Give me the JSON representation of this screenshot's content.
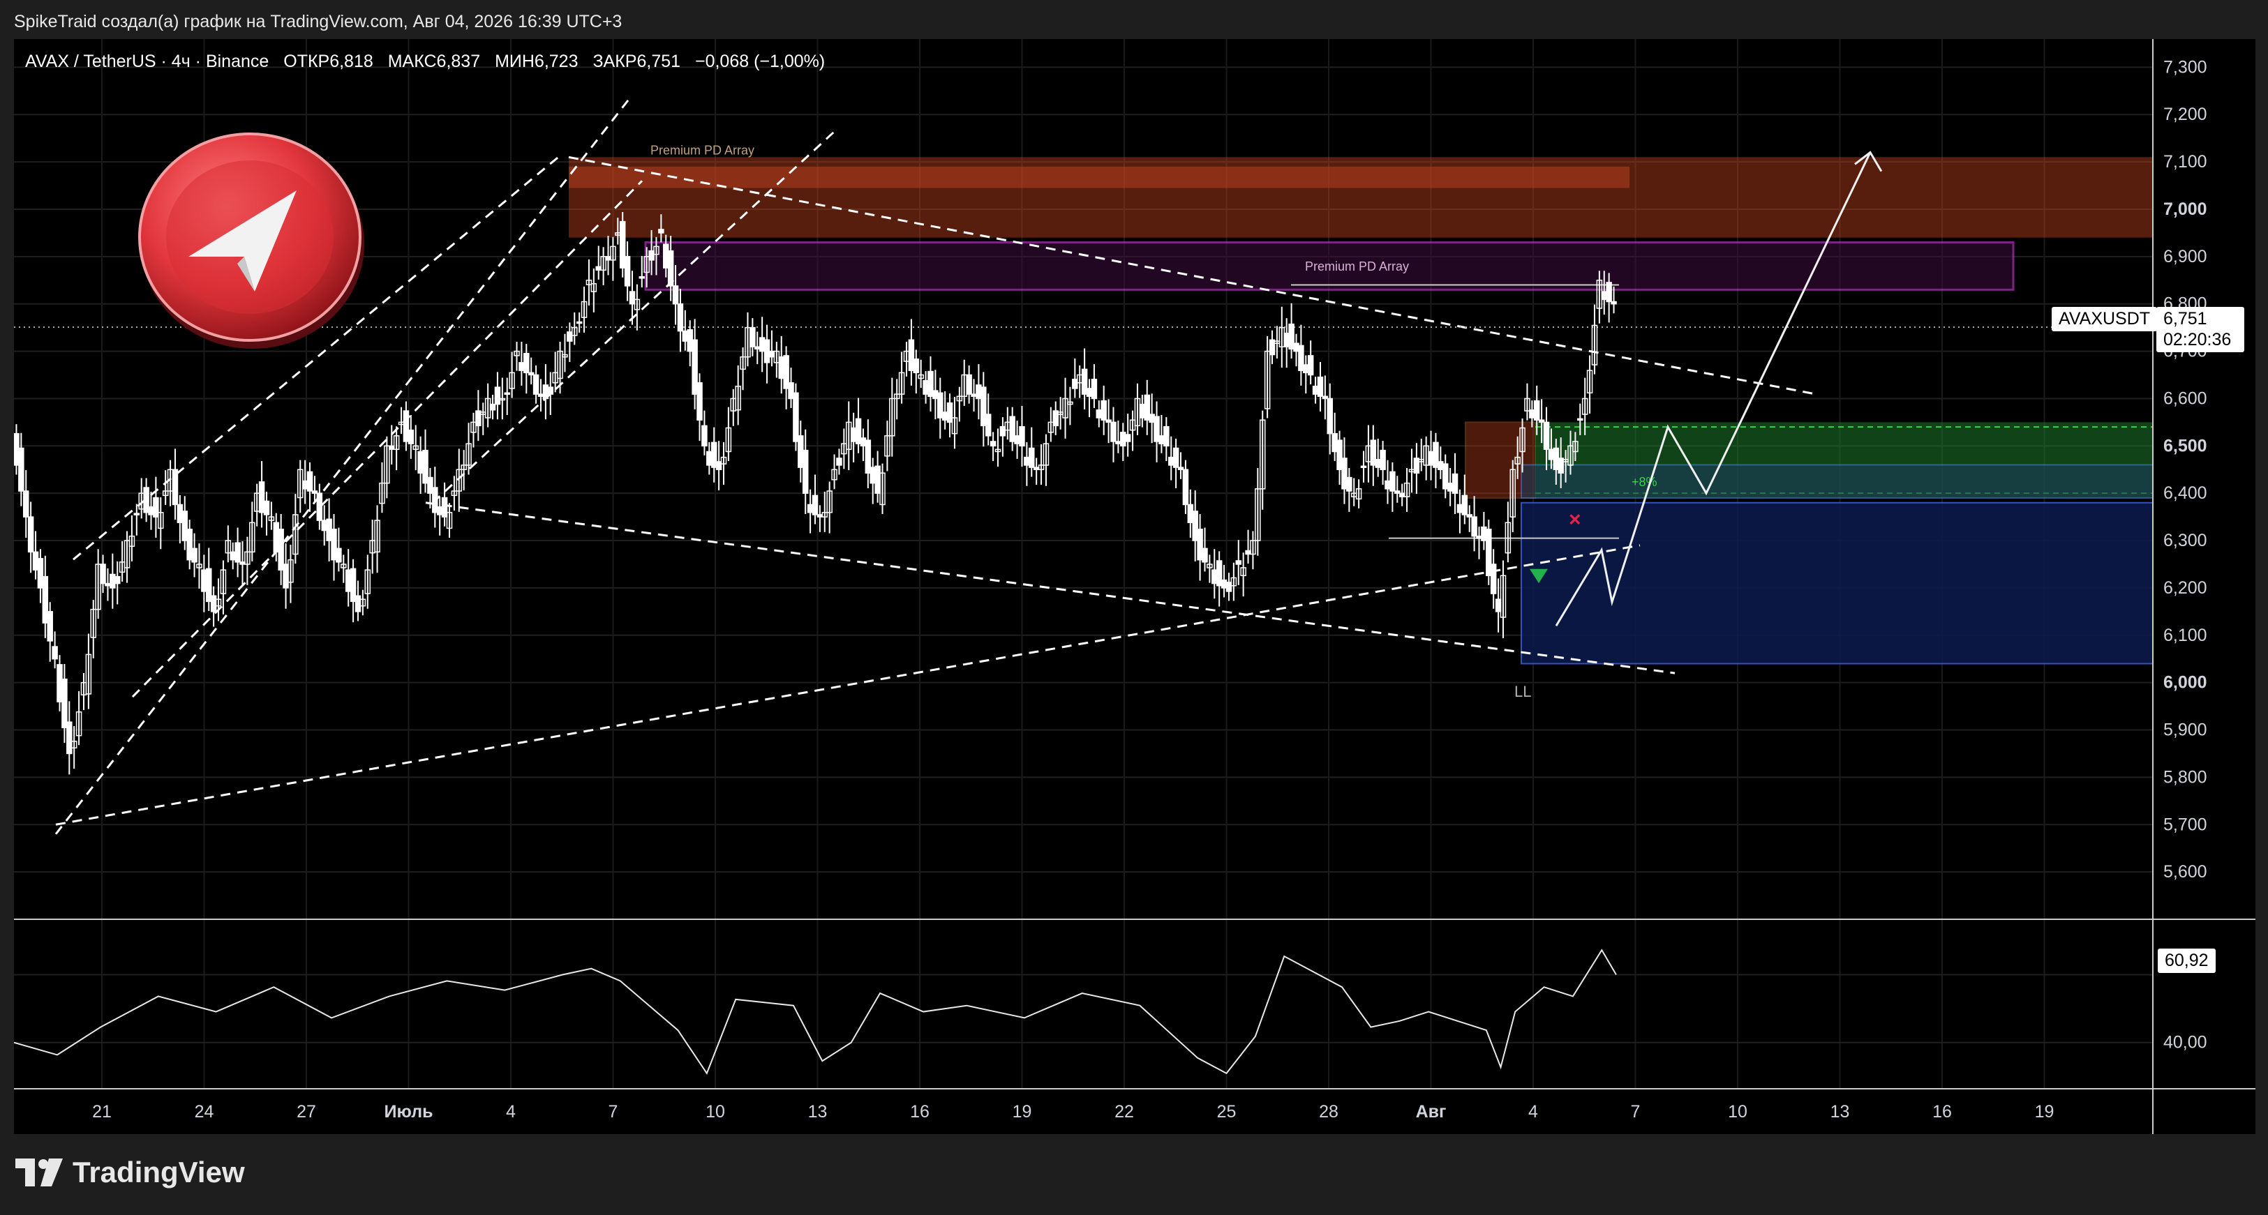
{
  "header": {
    "attribution": "SpikeTraid создал(а) график на TradingView.com, Авг 04, 2026 16:39 UTC+3"
  },
  "symbol": {
    "name": "AVAX / TetherUS · 4ч · Binance",
    "open": "ОТКР6,818",
    "high": "МАКС6,837",
    "low": "МИН6,723",
    "close": "ЗАКР6,751",
    "change": "−0,068 (−1,00%)"
  },
  "price_badge": {
    "ticker": "AVAXUSDT",
    "price": "6,751",
    "countdown": "02:20:36"
  },
  "rsi_badge": {
    "value": "60,92"
  },
  "annotations": {
    "premium_1": "Premium PD Array",
    "premium_2": "Premium PD Array",
    "ll": "LL",
    "plus_label": "+8%"
  },
  "footer": {
    "logo_text": "TradingView"
  },
  "colors": {
    "background": "#000000",
    "candle": "#ffffff",
    "premium_zone": "#c0421f",
    "magenta_box": "#c83cd6",
    "green_zone": "#1e7a2a",
    "blue_zone": "#0c1a4a",
    "trendline": "#ffffff",
    "logo_red": "#e1363c"
  },
  "chart_data": {
    "type": "candlestick",
    "interval": "4h",
    "price_axis_ticks": [
      "7,300",
      "7,200",
      "7,100",
      "7,000",
      "6,900",
      "6,800",
      "6,700",
      "6,600",
      "6,500",
      "6,400",
      "6,300",
      "6,200",
      "6,100",
      "6,000",
      "5,900",
      "5,800",
      "5,700",
      "5,600"
    ],
    "rsi_axis_ticks": [
      "40,00"
    ],
    "x_tick_labels": [
      "21",
      "24",
      "27",
      "Июль",
      "4",
      "7",
      "10",
      "13",
      "16",
      "19",
      "22",
      "25",
      "28",
      "Авг",
      "4",
      "7",
      "10",
      "13",
      "16",
      "19"
    ],
    "ylim": [
      5.5,
      7.33
    ],
    "rsi_ylim": [
      25,
      80
    ],
    "last_price": 6.751,
    "rsi_last": 60.92,
    "price_path": [
      [
        0,
        6.55
      ],
      [
        1,
        6.35
      ],
      [
        2,
        6.2
      ],
      [
        3,
        6.05
      ],
      [
        4,
        5.85
      ],
      [
        5,
        6.0
      ],
      [
        6,
        6.25
      ],
      [
        7,
        6.2
      ],
      [
        8,
        6.3
      ],
      [
        9,
        6.4
      ],
      [
        10,
        6.35
      ],
      [
        11,
        6.45
      ],
      [
        12,
        6.3
      ],
      [
        13,
        6.25
      ],
      [
        14,
        6.15
      ],
      [
        15,
        6.3
      ],
      [
        16,
        6.25
      ],
      [
        17,
        6.4
      ],
      [
        18,
        6.35
      ],
      [
        19,
        6.2
      ],
      [
        20,
        6.45
      ],
      [
        21,
        6.4
      ],
      [
        22,
        6.3
      ],
      [
        23,
        6.25
      ],
      [
        24,
        6.15
      ],
      [
        25,
        6.3
      ],
      [
        26,
        6.5
      ],
      [
        27,
        6.55
      ],
      [
        28,
        6.5
      ],
      [
        29,
        6.4
      ],
      [
        30,
        6.35
      ],
      [
        31,
        6.45
      ],
      [
        32,
        6.55
      ],
      [
        33,
        6.6
      ],
      [
        34,
        6.6
      ],
      [
        35,
        6.7
      ],
      [
        36,
        6.65
      ],
      [
        37,
        6.6
      ],
      [
        38,
        6.7
      ],
      [
        39,
        6.75
      ],
      [
        40,
        6.85
      ],
      [
        41,
        6.9
      ],
      [
        42,
        6.95
      ],
      [
        43,
        6.8
      ],
      [
        44,
        6.9
      ],
      [
        45,
        6.95
      ],
      [
        46,
        6.8
      ],
      [
        47,
        6.7
      ],
      [
        48,
        6.5
      ],
      [
        49,
        6.45
      ],
      [
        50,
        6.6
      ],
      [
        51,
        6.75
      ],
      [
        52,
        6.7
      ],
      [
        53,
        6.7
      ],
      [
        54,
        6.6
      ],
      [
        55,
        6.4
      ],
      [
        56,
        6.35
      ],
      [
        57,
        6.45
      ],
      [
        58,
        6.55
      ],
      [
        59,
        6.5
      ],
      [
        60,
        6.4
      ],
      [
        61,
        6.6
      ],
      [
        62,
        6.7
      ],
      [
        63,
        6.65
      ],
      [
        64,
        6.6
      ],
      [
        65,
        6.55
      ],
      [
        66,
        6.65
      ],
      [
        67,
        6.6
      ],
      [
        68,
        6.5
      ],
      [
        69,
        6.55
      ],
      [
        70,
        6.5
      ],
      [
        71,
        6.45
      ],
      [
        72,
        6.55
      ],
      [
        73,
        6.6
      ],
      [
        74,
        6.65
      ],
      [
        75,
        6.6
      ],
      [
        76,
        6.55
      ],
      [
        77,
        6.5
      ],
      [
        78,
        6.6
      ],
      [
        79,
        6.55
      ],
      [
        80,
        6.5
      ],
      [
        81,
        6.45
      ],
      [
        82,
        6.3
      ],
      [
        83,
        6.25
      ],
      [
        84,
        6.2
      ],
      [
        85,
        6.25
      ],
      [
        86,
        6.3
      ],
      [
        87,
        6.7
      ],
      [
        88,
        6.75
      ],
      [
        89,
        6.7
      ],
      [
        90,
        6.65
      ],
      [
        91,
        6.6
      ],
      [
        92,
        6.45
      ],
      [
        93,
        6.4
      ],
      [
        94,
        6.5
      ],
      [
        95,
        6.45
      ],
      [
        96,
        6.4
      ],
      [
        97,
        6.45
      ],
      [
        98,
        6.5
      ],
      [
        99,
        6.45
      ],
      [
        100,
        6.4
      ],
      [
        101,
        6.35
      ],
      [
        102,
        6.3
      ],
      [
        103,
        6.15
      ],
      [
        104,
        6.45
      ],
      [
        105,
        6.6
      ],
      [
        106,
        6.55
      ],
      [
        107,
        6.45
      ],
      [
        108,
        6.5
      ],
      [
        109,
        6.6
      ],
      [
        110,
        6.85
      ],
      [
        111,
        6.8
      ]
    ],
    "rsi_path": [
      [
        0,
        40
      ],
      [
        3,
        36
      ],
      [
        6,
        45
      ],
      [
        10,
        55
      ],
      [
        14,
        50
      ],
      [
        18,
        58
      ],
      [
        22,
        48
      ],
      [
        26,
        55
      ],
      [
        30,
        60
      ],
      [
        34,
        57
      ],
      [
        38,
        62
      ],
      [
        40,
        64
      ],
      [
        42,
        60
      ],
      [
        44,
        52
      ],
      [
        46,
        44
      ],
      [
        48,
        30
      ],
      [
        50,
        54
      ],
      [
        54,
        52
      ],
      [
        56,
        34
      ],
      [
        58,
        40
      ],
      [
        60,
        56
      ],
      [
        63,
        50
      ],
      [
        66,
        52
      ],
      [
        70,
        48
      ],
      [
        74,
        56
      ],
      [
        78,
        52
      ],
      [
        82,
        35
      ],
      [
        84,
        30
      ],
      [
        86,
        42
      ],
      [
        88,
        68
      ],
      [
        90,
        63
      ],
      [
        92,
        58
      ],
      [
        94,
        45
      ],
      [
        96,
        47
      ],
      [
        98,
        50
      ],
      [
        100,
        47
      ],
      [
        102,
        44
      ],
      [
        103,
        32
      ],
      [
        104,
        50
      ],
      [
        106,
        58
      ],
      [
        108,
        55
      ],
      [
        110,
        70
      ],
      [
        111,
        62
      ]
    ],
    "annotations": [
      "Premium PD Array",
      "Premium PD Array",
      "LL",
      "+8%"
    ]
  }
}
